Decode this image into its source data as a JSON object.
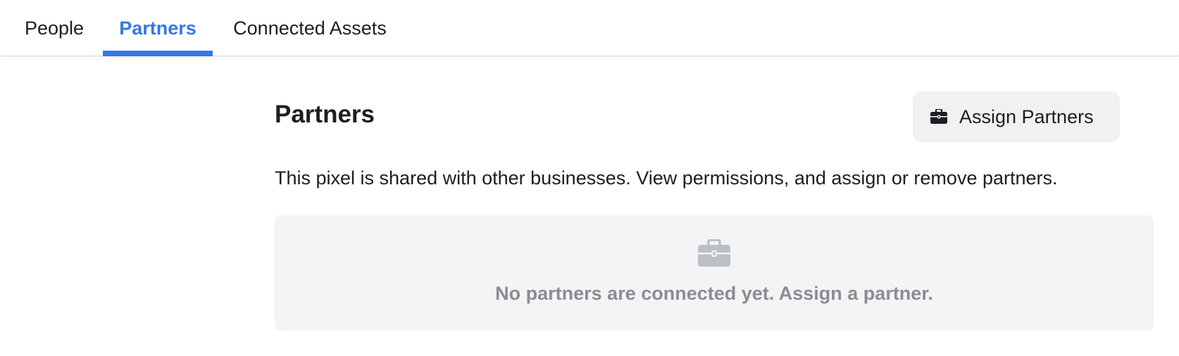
{
  "tabs": {
    "people": "People",
    "partners": "Partners",
    "connected_assets": "Connected Assets",
    "active": "Partners"
  },
  "section": {
    "title": "Partners",
    "description": "This pixel is shared with other businesses. View permissions, and assign or remove partners."
  },
  "assign_button": {
    "label": "Assign Partners",
    "icon": "briefcase-icon"
  },
  "empty_state": {
    "icon": "briefcase-icon",
    "message": "No partners are connected yet. Assign a partner."
  },
  "colors": {
    "accent": "#3578e5",
    "text": "#1c1e21",
    "muted": "#8a8d91",
    "panel_bg": "#f3f4f6",
    "button_bg": "#f0f1f3"
  }
}
